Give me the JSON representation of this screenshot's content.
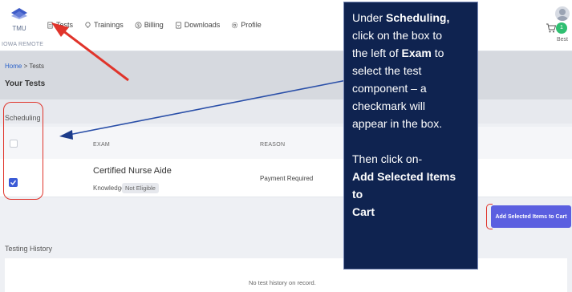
{
  "header": {
    "logo_text": "TMU",
    "logo_sub": "IOWA REMOTE",
    "nav": [
      {
        "label": "Tests",
        "icon": "document-icon"
      },
      {
        "label": "Trainings",
        "icon": "lightbulb-icon"
      },
      {
        "label": "Billing",
        "icon": "dollar-icon"
      },
      {
        "label": "Downloads",
        "icon": "download-icon"
      },
      {
        "label": "Profile",
        "icon": "gear-icon"
      }
    ],
    "cart_icon": "cart-icon",
    "avatar_badge": "1",
    "avatar_name": "Best"
  },
  "breadcrumb": {
    "home": "Home",
    "separator": ">",
    "current": "Tests"
  },
  "page_title": "Your Tests",
  "scheduling": {
    "label": "Scheduling",
    "columns": [
      "EXAM",
      "REASON"
    ],
    "rows": [
      {
        "checked": true,
        "exam": "Certified Nurse Aide",
        "type": "Knowledge",
        "status": "Not Eligible",
        "reason": "Payment Required"
      }
    ]
  },
  "add_button": "Add Selected Items to Cart",
  "history": {
    "label": "Testing History",
    "empty": "No test history on record."
  },
  "callout": {
    "l1_pre": "Under ",
    "l1_bold": "Scheduling,",
    "l2": "click on the box to",
    "l3_pre": "the left of ",
    "l3_bold": "Exam",
    "l3_post": " to",
    "l4": "select the test",
    "l5": "component – a",
    "l6": "checkmark will",
    "l7": "appear in the box.",
    "l8": "Then click on-",
    "l9": "Add Selected Items to",
    "l10": "Cart"
  },
  "colors": {
    "accent": "#5b5fe0",
    "callout_bg": "#0f2350",
    "annotation_red": "#e0342b",
    "checkbox_blue": "#3b5bd6",
    "badge_green": "#2fbf71"
  }
}
